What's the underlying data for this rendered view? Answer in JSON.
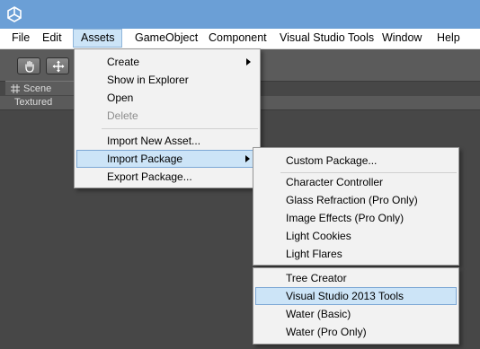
{
  "menubar": {
    "items": [
      "File",
      "Edit",
      "Assets",
      "GameObject",
      "Component",
      "Visual Studio Tools",
      "Window",
      "Help"
    ],
    "active": "Assets"
  },
  "toolbar": {
    "tools": [
      "hand-tool-icon",
      "move-tool-icon"
    ]
  },
  "scene": {
    "tab_label": "Scene",
    "shading_mode": "Textured"
  },
  "assets_menu": {
    "group1": [
      {
        "label": "Create",
        "submenu": true,
        "disabled": false
      },
      {
        "label": "Show in Explorer",
        "submenu": false,
        "disabled": false
      },
      {
        "label": "Open",
        "submenu": false,
        "disabled": false
      },
      {
        "label": "Delete",
        "submenu": false,
        "disabled": true
      }
    ],
    "group2": [
      {
        "label": "Import New Asset...",
        "submenu": false
      },
      {
        "label": "Import Package",
        "submenu": true,
        "highlighted": true
      },
      {
        "label": "Export Package...",
        "submenu": false
      }
    ]
  },
  "import_package_menu": {
    "custom": "Custom Package...",
    "packages": [
      "Character Controller",
      "Glass Refraction (Pro Only)",
      "Image Effects (Pro Only)",
      "Light Cookies",
      "Light Flares"
    ]
  },
  "packages_menu2": {
    "items": [
      "Tree Creator",
      "Visual Studio 2013 Tools",
      "Water (Basic)",
      "Water (Pro Only)"
    ],
    "highlighted": "Visual Studio 2013 Tools"
  },
  "colors": {
    "titlebar": "#6b9fd6",
    "menu_highlight": "#cce4f7",
    "editor_background": "#474747"
  }
}
